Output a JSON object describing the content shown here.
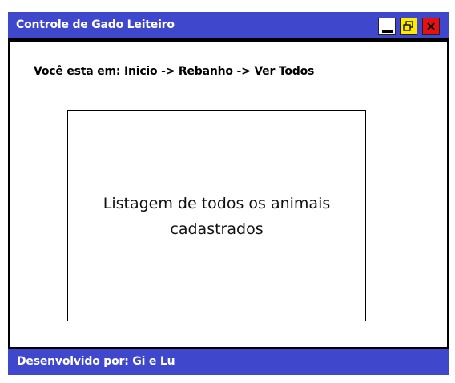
{
  "window": {
    "title": "Controle de Gado Leiteiro",
    "controls": {
      "minimize_icon": "minimize-icon",
      "restore_icon": "restore-icon",
      "close_icon": "close-icon"
    }
  },
  "breadcrumb": {
    "text": "Você esta em: Inicio -> Rebanho -> Ver Todos"
  },
  "main": {
    "listing_placeholder": "Listagem de todos os animais cadastrados"
  },
  "footer": {
    "text": "Desenvolvido por: Gi e Lu"
  },
  "colors": {
    "titlebar": "#3f48cc",
    "restore_button": "#ffeb00",
    "close_button": "#e51010"
  }
}
